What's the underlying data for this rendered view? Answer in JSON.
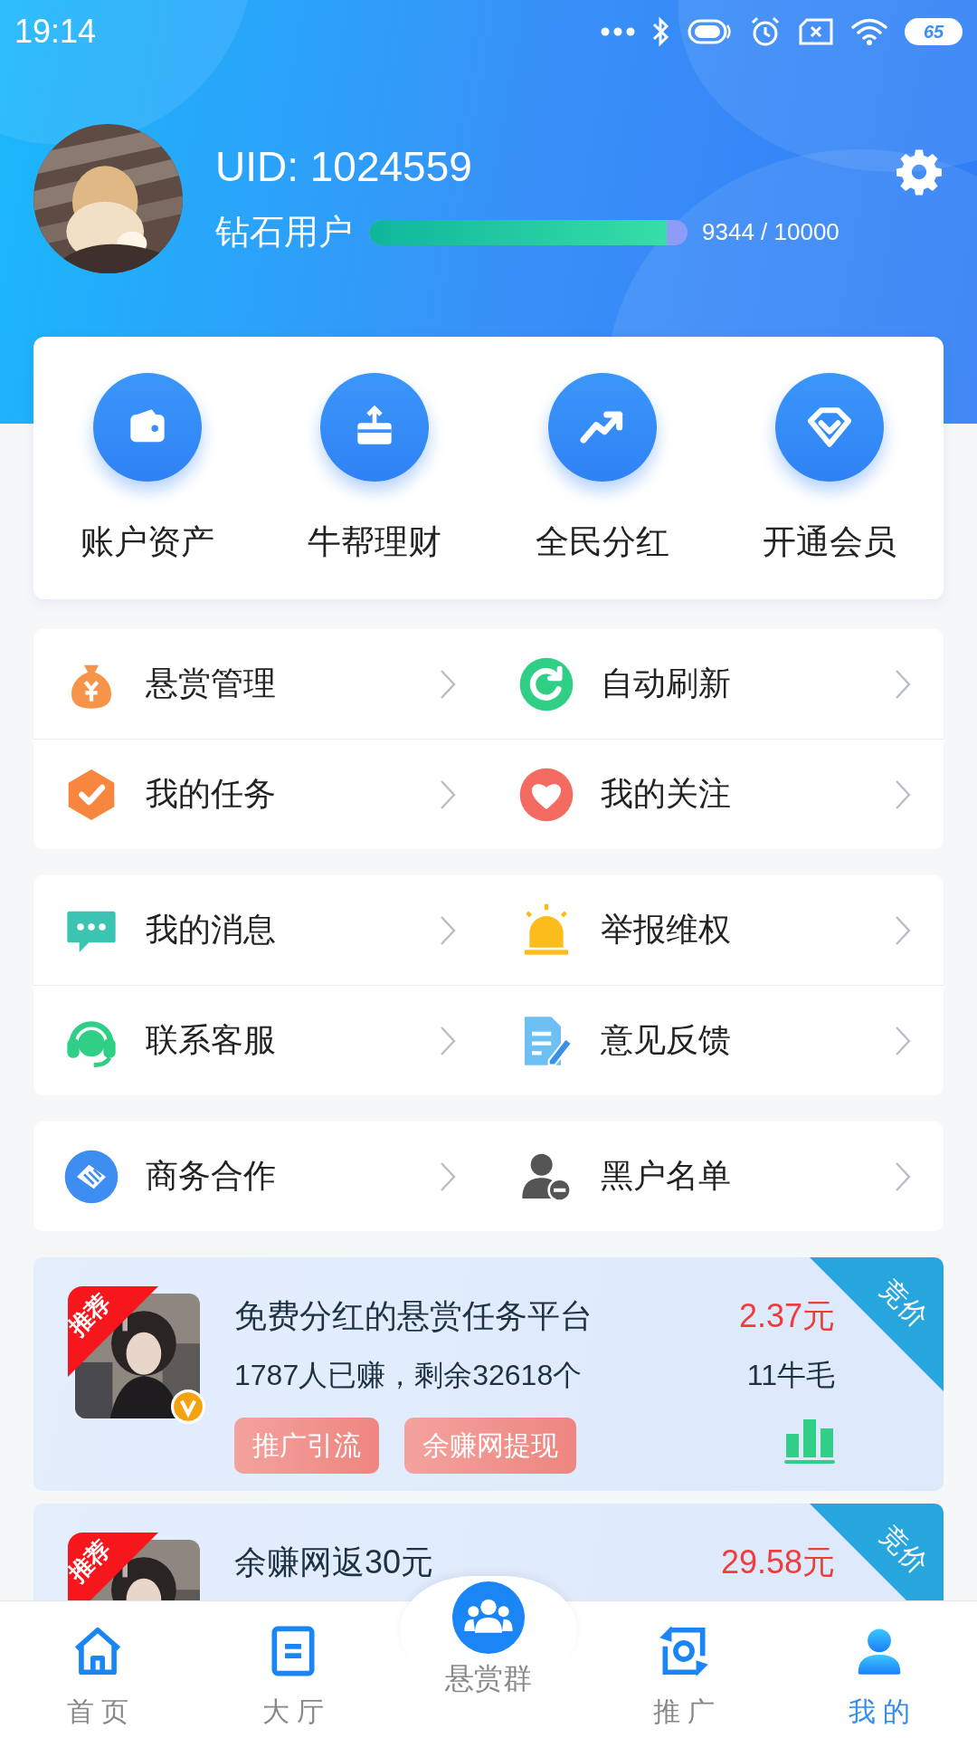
{
  "status_bar": {
    "time": "19:14",
    "battery": "65"
  },
  "profile": {
    "uid": "UID: 1024559",
    "tier": "钻石用户",
    "level": 0.9344,
    "points": "9344 / 10000"
  },
  "quick_actions": [
    {
      "label": "账户资产",
      "kind": "wallet"
    },
    {
      "label": "牛帮理财",
      "kind": "card"
    },
    {
      "label": "全民分红",
      "kind": "trend"
    },
    {
      "label": "开通会员",
      "kind": "diamond"
    }
  ],
  "menu_groups": [
    [
      {
        "label": "悬赏管理",
        "kind": "moneybag"
      },
      {
        "label": "自动刷新",
        "kind": "refresh"
      },
      {
        "label": "我的任务",
        "kind": "task"
      },
      {
        "label": "我的关注",
        "kind": "heart"
      }
    ],
    [
      {
        "label": "我的消息",
        "kind": "message"
      },
      {
        "label": "举报维权",
        "kind": "alarm"
      },
      {
        "label": "联系客服",
        "kind": "headset"
      },
      {
        "label": "意见反馈",
        "kind": "feedback"
      }
    ],
    [
      {
        "label": "商务合作",
        "kind": "handshake"
      },
      {
        "label": "黑户名单",
        "kind": "blacklist"
      }
    ]
  ],
  "tasks": [
    {
      "badge": "推荐",
      "verified": true,
      "corner": "竞价",
      "title": "免费分红的悬赏任务平台",
      "price": "2.37元",
      "subtitle": "1787人已赚，剩余32618个",
      "reward": "11牛毛",
      "tags": [
        "推广引流",
        "余赚网提现"
      ]
    },
    {
      "badge": "推荐",
      "verified": false,
      "corner": "竞价",
      "title": "余赚网返30元",
      "price": "29.58元"
    }
  ],
  "tab_bar": [
    {
      "label": "首 页",
      "kind": "home",
      "selected": false
    },
    {
      "label": "大 厅",
      "kind": "hall",
      "selected": false
    },
    {
      "label": "悬赏群",
      "kind": "group",
      "selected": false
    },
    {
      "label": "推 广",
      "kind": "promote",
      "selected": false
    },
    {
      "label": "我 的",
      "kind": "me",
      "selected": true
    }
  ]
}
